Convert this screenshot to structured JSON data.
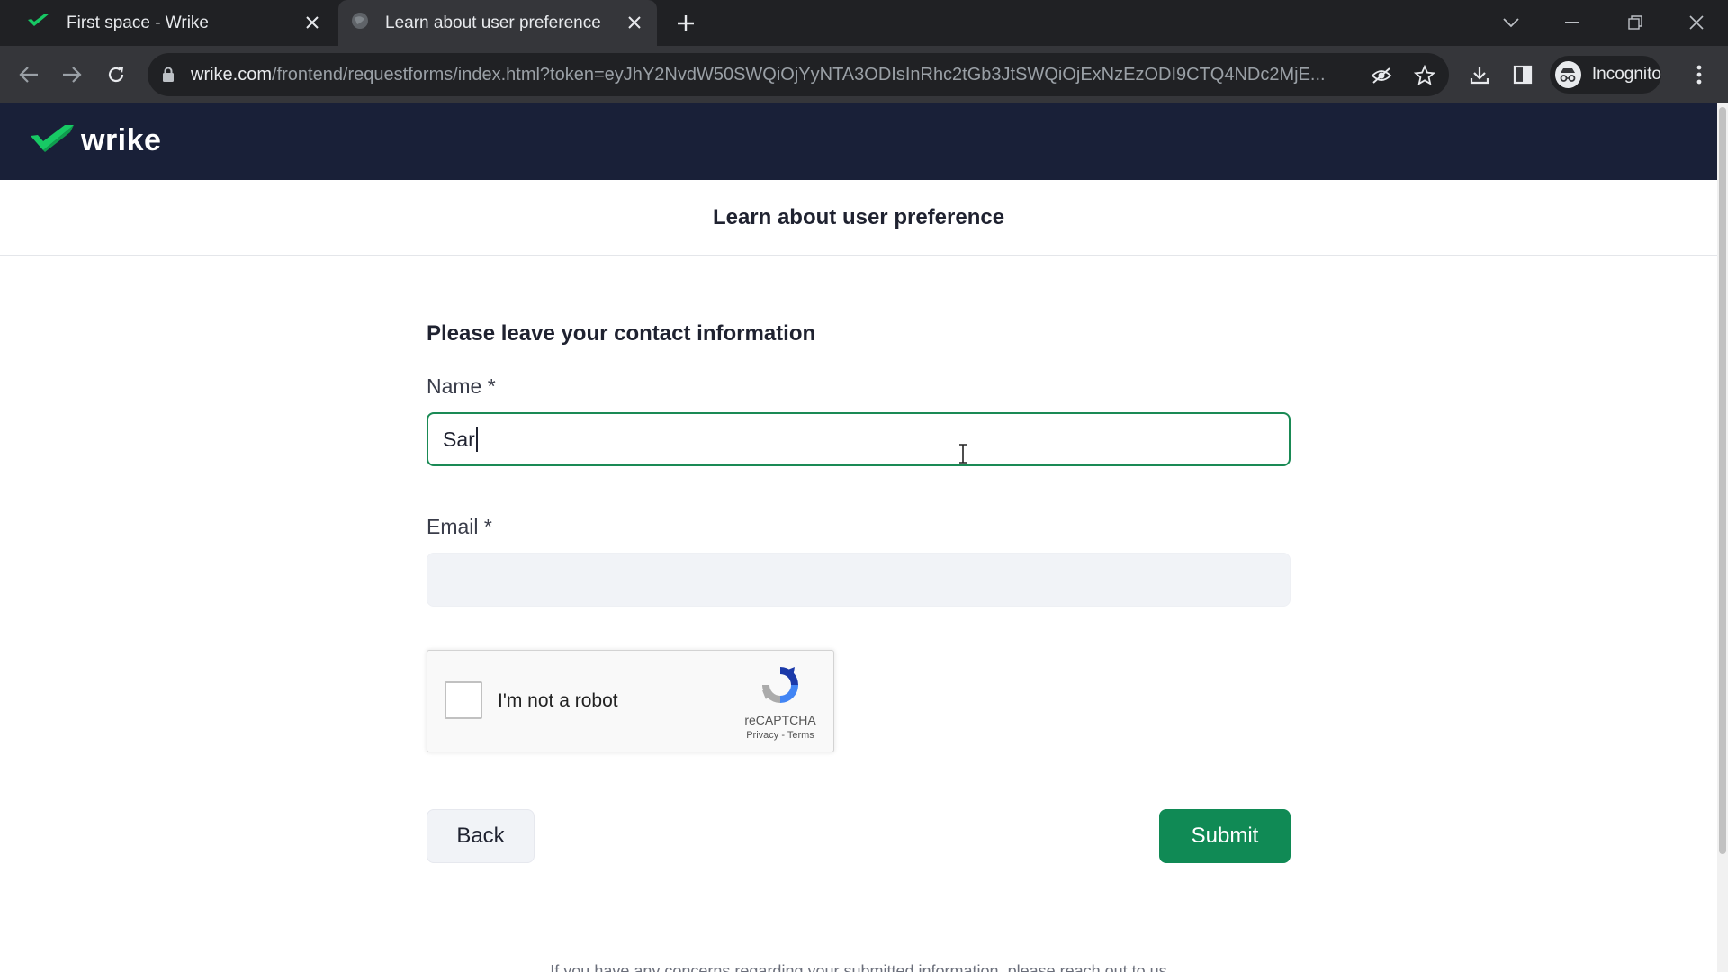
{
  "browser": {
    "tabs": [
      {
        "title": "First space - Wrike",
        "icon": "wrike-check-icon",
        "active": false
      },
      {
        "title": "Learn about user preference",
        "icon": "globe-icon",
        "active": true
      }
    ],
    "url_host": "wrike.com",
    "url_path": "/frontend/requestforms/index.html?token=eyJhY2NvdW50SWQiOjYyNTA3ODIsInRhc2tGb3JtSWQiOjExNzEzODI9CTQ4NDc2MjE...",
    "profile_label": "Incognito"
  },
  "brand": {
    "name": "wrike",
    "accent": "#17c964",
    "header_bg": "#192038"
  },
  "form": {
    "title": "Learn about user preference",
    "section_title": "Please leave your contact information",
    "name_label": "Name *",
    "name_value": "Sar",
    "email_label": "Email *",
    "email_value": "",
    "recaptcha": {
      "label": "I'm not a robot",
      "brand": "reCAPTCHA",
      "privacy": "Privacy",
      "separator": " - ",
      "terms": "Terms"
    },
    "back_label": "Back",
    "submit_label": "Submit",
    "submit_color": "#108a55"
  },
  "footer": {
    "note": "If you have any concerns regarding your submitted information, please reach out to us"
  }
}
